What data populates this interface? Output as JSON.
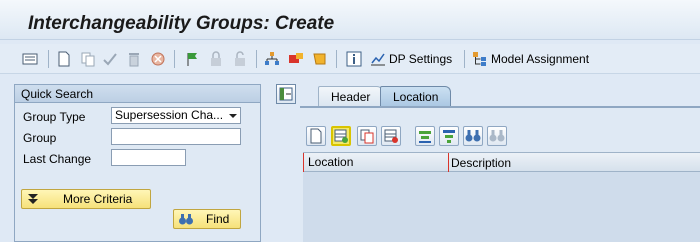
{
  "title": "Interchangeability Groups: Create",
  "toolbar": {
    "dp_settings_label": "DP Settings",
    "model_assignment_label": "Model Assignment"
  },
  "quick_search": {
    "title": "Quick Search",
    "group_type_label": "Group Type",
    "group_type_value": "Supersession Cha...",
    "group_label": "Group",
    "group_value": "",
    "last_change_label": "Last Change",
    "last_change_value": "",
    "more_criteria_label": "More Criteria",
    "find_label": "Find"
  },
  "tabs": [
    {
      "label": "Header",
      "active": false
    },
    {
      "label": "Location",
      "active": true
    }
  ],
  "table": {
    "columns": [
      "Location",
      "Description"
    ]
  }
}
